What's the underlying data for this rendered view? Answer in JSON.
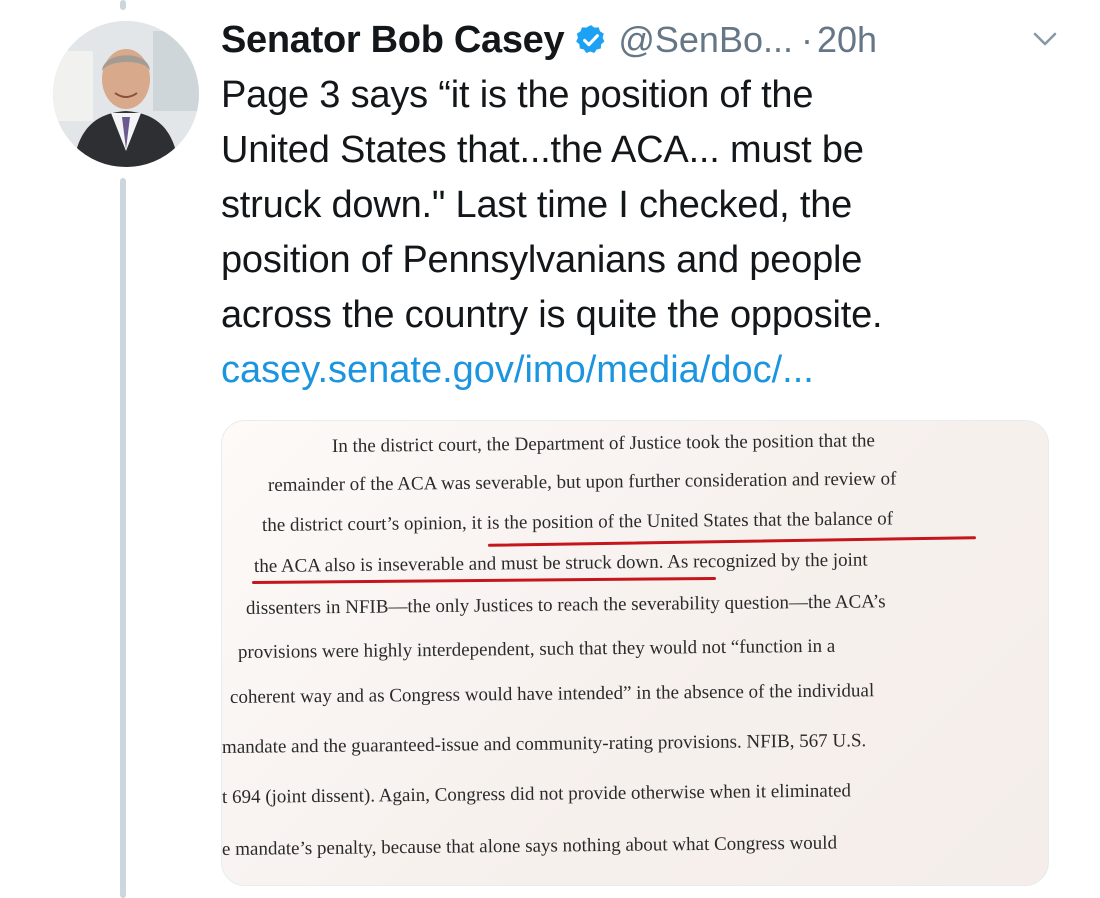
{
  "tweet": {
    "display_name": "Senator Bob Casey",
    "handle": "@SenBo...",
    "separator": "·",
    "time": "20h",
    "text_lines": [
      "Page 3 says “it is the position of the",
      "United States that...the ACA... must be",
      "struck down.\" Last time I checked, the",
      "position of Pennsylvanians and people",
      "across the country is quite the opposite."
    ],
    "link": "casey.senate.gov/imo/media/doc/...",
    "icons": {
      "verified": "verified-badge-icon",
      "menu": "chevron-down-icon"
    },
    "colors": {
      "link": "#1b95e0",
      "verified": "#1da1f2",
      "muted": "#657786",
      "underline": "#c4161c"
    }
  },
  "media": {
    "lines": [
      "In the district court, the Department of Justice took the position that the",
      "remainder of the ACA was severable, but upon further consideration and review of",
      "the district court’s opinion, it is the position of the United States that the balance of",
      "the ACA also is inseverable and must be struck down.  As recognized by the joint",
      "dissenters in NFIB—the only Justices to reach the severability question—the ACA’s",
      "provisions were highly interdependent, such that they would not “function in a",
      "coherent way and as Congress would have intended” in the absence of the individual",
      "mandate and the guaranteed-issue and community-rating provisions.  NFIB, 567 U.S.",
      "t 694 (joint dissent).  Again, Congress did not provide otherwise when it eliminated",
      "e mandate’s penalty, because that alone says nothing about what Congress would"
    ]
  }
}
